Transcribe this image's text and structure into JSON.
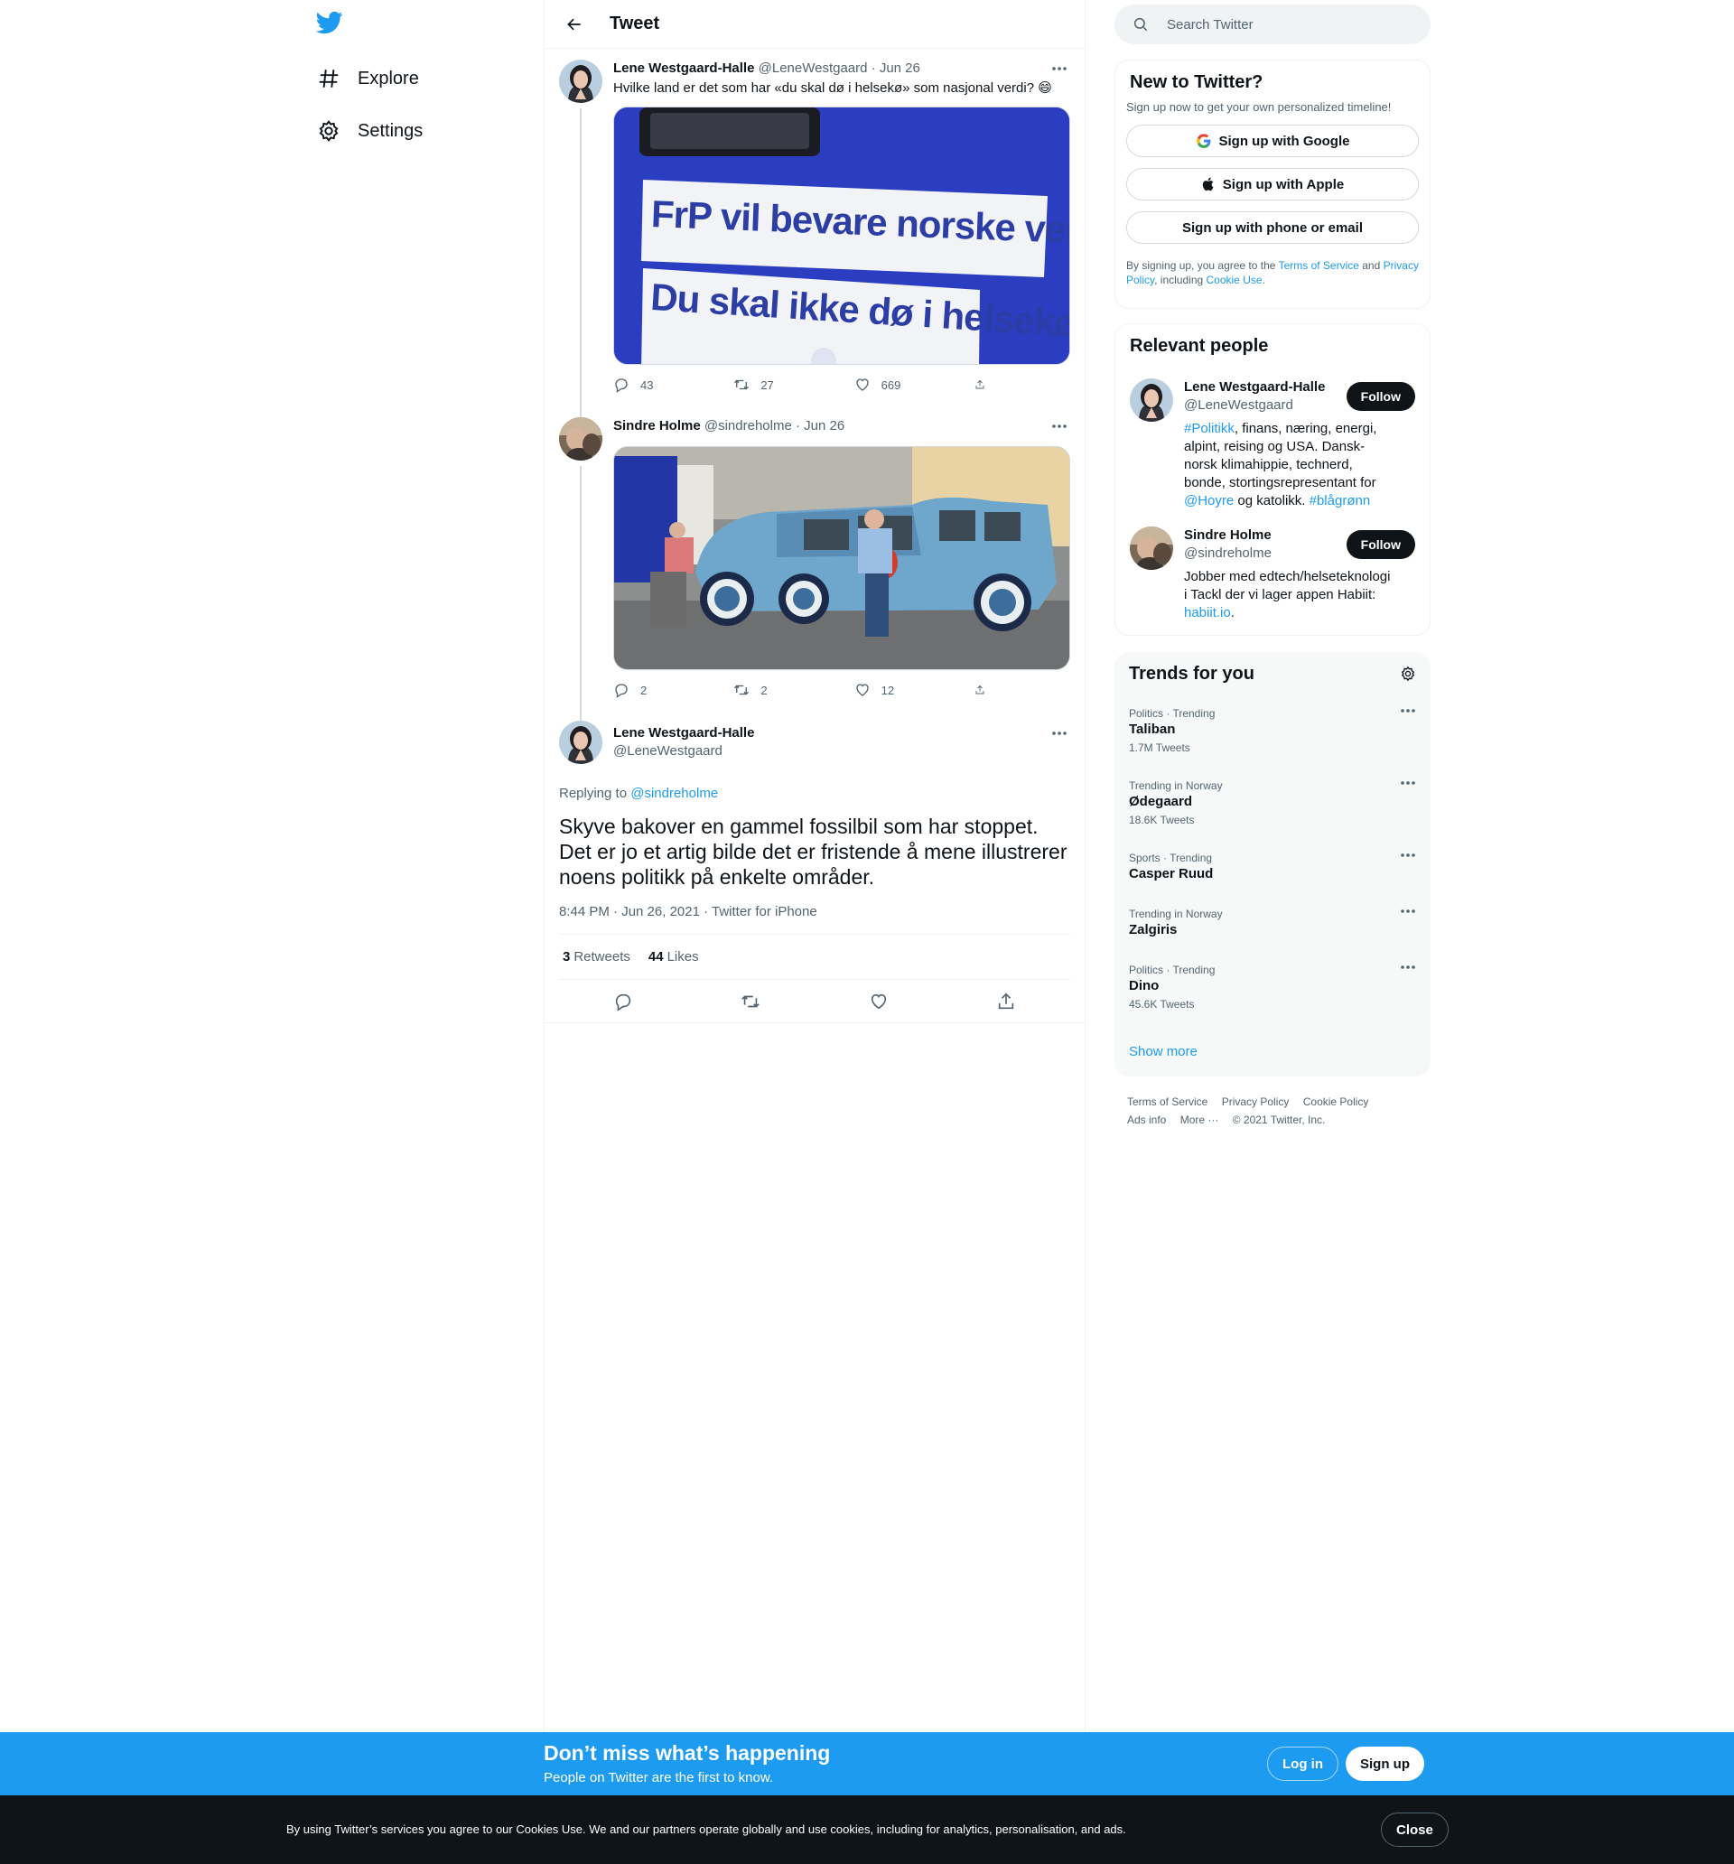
{
  "nav": {
    "items": [
      {
        "label": "Explore",
        "icon": "hashtag-icon"
      },
      {
        "label": "Settings",
        "icon": "gear-icon"
      }
    ]
  },
  "header": {
    "title": "Tweet"
  },
  "thread": [
    {
      "name": "Lene Westgaard-Halle",
      "handle": "@LeneWestgaard",
      "date": "· Jun 26",
      "text": "Hvilke land er det som har «du skal dø i helsekø» som nasjonal verdi? 😄",
      "media_text_1": "FrP vil bevare norske verdier",
      "media_text_2": "Du skal ikke dø i helsekø",
      "replies": "43",
      "retweets": "27",
      "likes": "669"
    },
    {
      "name": "Sindre Holme",
      "handle": "@sindreholme",
      "date": "· Jun 26",
      "replies": "2",
      "retweets": "2",
      "likes": "12"
    }
  ],
  "focus": {
    "name": "Lene Westgaard-Halle",
    "handle": "@LeneWestgaard",
    "replying_prefix": "Replying to ",
    "replying_to": "@sindreholme",
    "text": "Skyve bakover en gammel fossilbil som har stoppet. Det er jo et artig bilde det er fristende å mene illustrerer noens politikk på enkelte områder.",
    "meta": "8:44 PM · Jun 26, 2021 · Twitter for iPhone",
    "retweets_count": "3",
    "retweets_label": "Retweets",
    "likes_count": "44",
    "likes_label": "Likes"
  },
  "search": {
    "placeholder": "Search Twitter"
  },
  "signup": {
    "title": "New to Twitter?",
    "subtitle": "Sign up now to get your own personalized timeline!",
    "google": "Sign up with Google",
    "apple": "Sign up with Apple",
    "phone": "Sign up with phone or email",
    "legal_1": "By signing up, you agree to the ",
    "terms": "Terms of Service",
    "legal_2": " and ",
    "privacy": "Privacy Policy",
    "legal_3": ", including ",
    "cookie": "Cookie Use",
    "legal_4": "."
  },
  "relevant": {
    "title": "Relevant people",
    "follow_label": "Follow",
    "people": [
      {
        "name": "Lene Westgaard-Halle",
        "handle": "@LeneWestgaard",
        "bio_tag1": "#Politikk",
        "bio_a": ", finans, næring, energi, alpint, reising og USA. Dansk-norsk klimahippie, technerd, bonde, stortingsrepresentant for ",
        "bio_mention": "@Hoyre",
        "bio_b": " og katolikk. ",
        "bio_tag2": "#blågrønn"
      },
      {
        "name": "Sindre Holme",
        "handle": "@sindreholme",
        "bio_a": "Jobber med edtech/helseteknologi i Tackl der vi lager appen Habiit: ",
        "bio_link": "habiit.io",
        "bio_b": "."
      }
    ]
  },
  "trends": {
    "title": "Trends for you",
    "items": [
      {
        "context": "Politics · Trending",
        "name": "Taliban",
        "count": "1.7M Tweets"
      },
      {
        "context": "Trending in Norway",
        "name": "Ødegaard",
        "count": "18.6K Tweets"
      },
      {
        "context": "Sports · Trending",
        "name": "Casper Ruud",
        "count": ""
      },
      {
        "context": "Trending in Norway",
        "name": "Zalgiris",
        "count": ""
      },
      {
        "context": "Politics · Trending",
        "name": "Dino",
        "count": "45.6K Tweets"
      }
    ],
    "show_more": "Show more"
  },
  "footer": {
    "terms": "Terms of Service",
    "privacy": "Privacy Policy",
    "cookie": "Cookie Policy",
    "ads": "Ads info",
    "more": "More ···",
    "copyright": "© 2021 Twitter, Inc."
  },
  "signup_bar": {
    "title": "Don’t miss what’s happening",
    "subtitle": "People on Twitter are the first to know.",
    "login": "Log in",
    "signup": "Sign up"
  },
  "cookie_bar": {
    "text": "By using Twitter’s services you agree to our Cookies Use. We and our partners operate globally and use cookies, including for analytics, personalisation, and ads.",
    "close": "Close"
  },
  "colors": {
    "accent": "#1d9bf0",
    "text": "#0f1419",
    "secondary": "#536471",
    "border": "#eff3f4"
  }
}
